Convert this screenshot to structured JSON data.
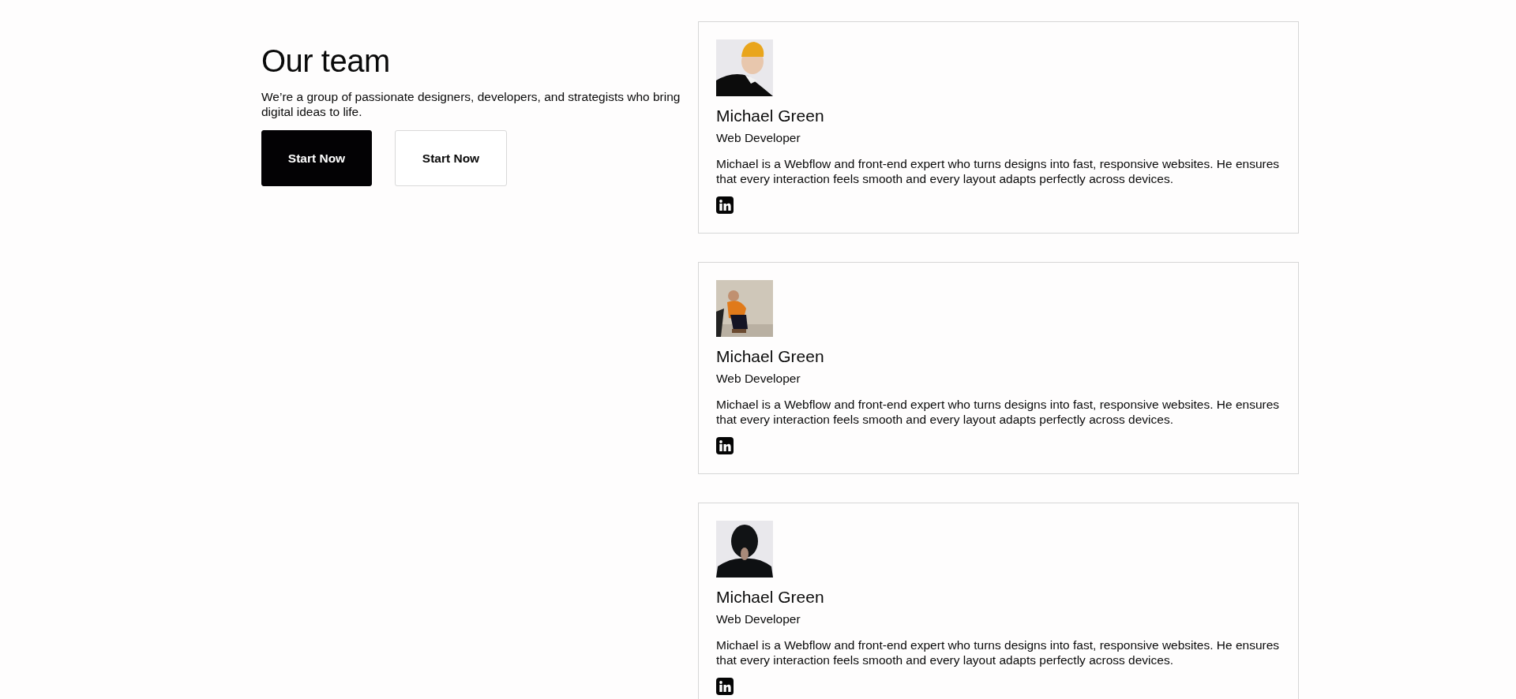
{
  "intro": {
    "heading": "Our team",
    "text": "We’re a group of passionate designers, developers, and strategists who bring digital ideas to life.",
    "buttons": [
      {
        "label": "Start Now",
        "kind": "primary"
      },
      {
        "label": "Start Now",
        "kind": "secondary"
      }
    ]
  },
  "members": [
    {
      "name": "Michael Green",
      "role": "Web Developer",
      "bio": "Michael is a Webflow and front-end expert who turns designs into fast, responsive websites. He ensures that every interaction feels smooth and every layout adapts perfectly across devices."
    },
    {
      "name": "Michael Green",
      "role": "Web Developer",
      "bio": "Michael is a Webflow and front-end expert who turns designs into fast, responsive websites. He ensures that every interaction feels smooth and every layout adapts perfectly across devices."
    },
    {
      "name": "Michael Green",
      "role": "Web Developer",
      "bio": "Michael is a Webflow and front-end expert who turns designs into fast, responsive websites. He ensures that every interaction feels smooth and every layout adapts perfectly across devices."
    }
  ]
}
